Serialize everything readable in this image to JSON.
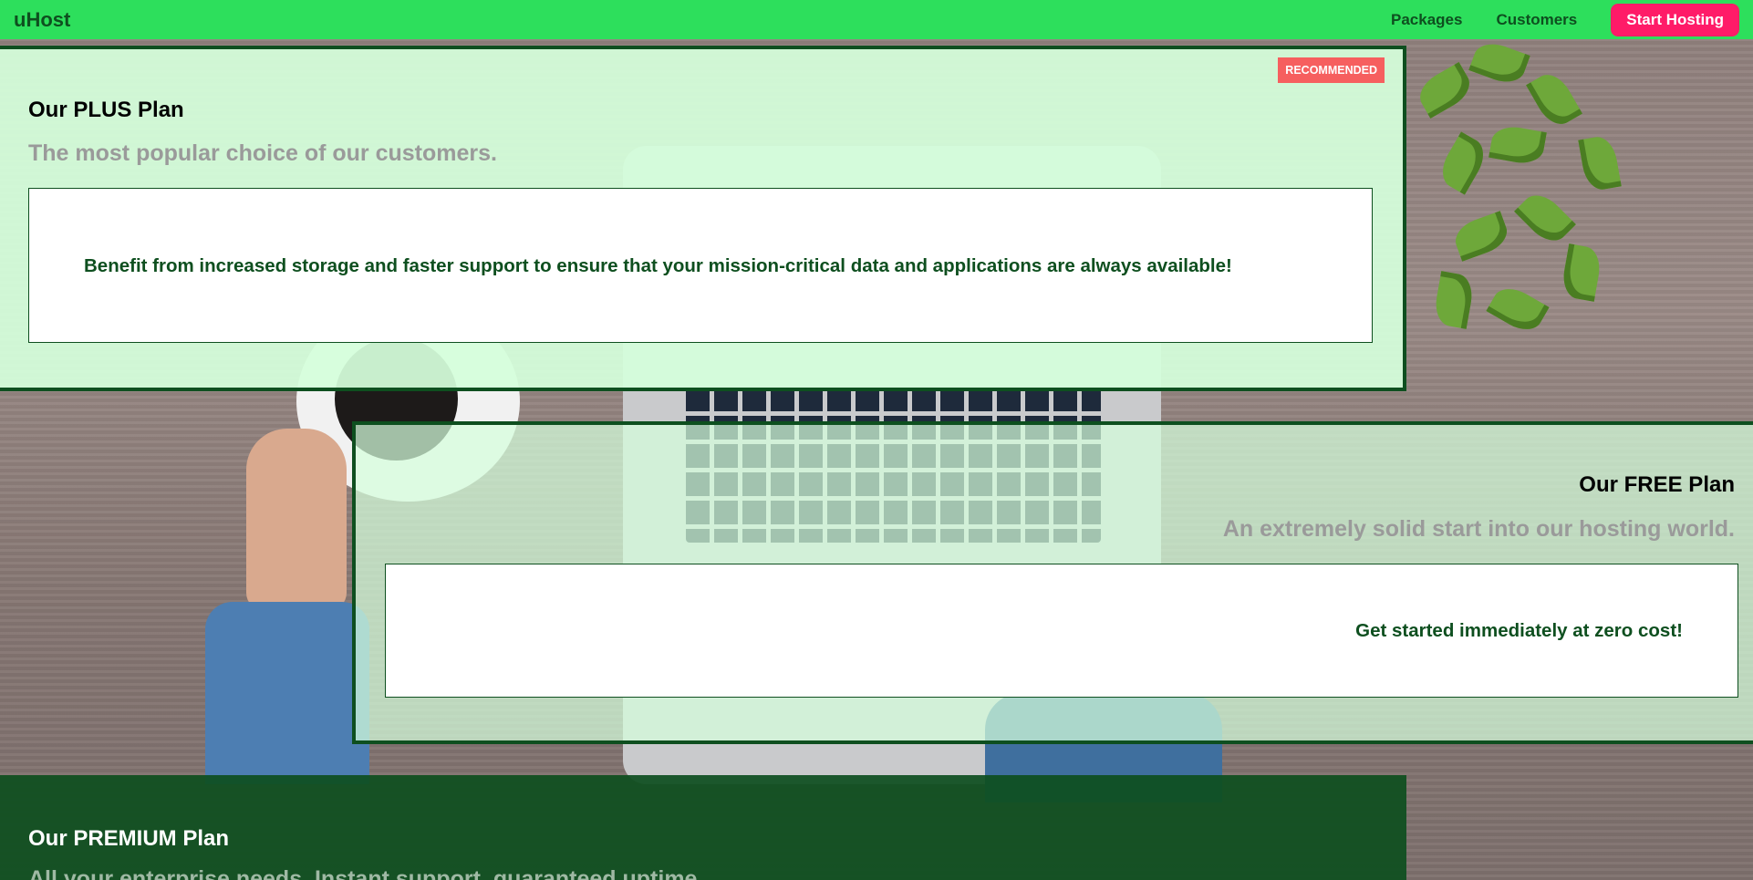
{
  "nav": {
    "brand": "uHost",
    "links": [
      {
        "label": "Packages"
      },
      {
        "label": "Customers"
      }
    ],
    "cta_label": "Start Hosting"
  },
  "plans": {
    "plus": {
      "badge": "RECOMMENDED",
      "title": "Our PLUS Plan",
      "subtitle": "The most popular choice of our customers.",
      "description": "Benefit from increased storage and faster support to ensure that your mission-critical data and applications are always available!"
    },
    "free": {
      "title": "Our FREE Plan",
      "subtitle": "An extremely solid start into our hosting world.",
      "description": "Get started immediately at zero cost!"
    },
    "premium": {
      "title": "Our PREMIUM Plan",
      "subtitle": "All your enterprise needs. Instant support, guaranteed uptime."
    }
  },
  "colors": {
    "nav_bg": "#2ddf5c",
    "brand_dark_green": "#0e4f1f",
    "cta_pink": "#ff1b68",
    "badge_red": "#f65f5f",
    "plan_light_green": "#d5ffdc"
  },
  "background": {
    "image": "desk-with-laptop-coffee-plant"
  }
}
